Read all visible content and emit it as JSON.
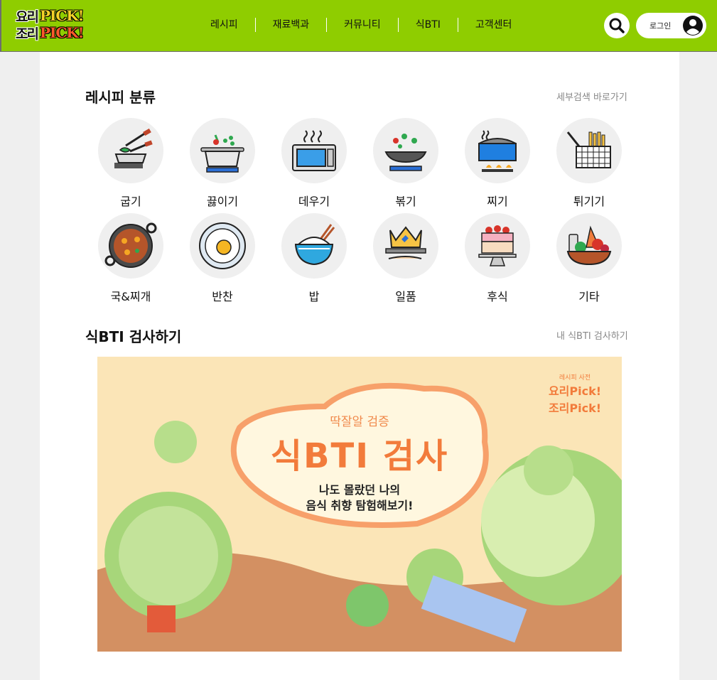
{
  "header": {
    "logo": {
      "line1_ko": "요리",
      "line1_en": "PICK!",
      "line2_ko": "조리",
      "line2_en": "PICK!"
    },
    "nav": [
      "레시피",
      "재료백과",
      "커뮤니티",
      "식BTI",
      "고객센터"
    ],
    "login_label": "로그인",
    "search_icon": "search-icon",
    "user_icon": "user-icon"
  },
  "recipe_section": {
    "title": "레시피 분류",
    "link": "세부검색 바로가기",
    "categories": [
      {
        "name": "굽기",
        "icon": "grill-icon"
      },
      {
        "name": "끓이기",
        "icon": "boil-pot-icon"
      },
      {
        "name": "데우기",
        "icon": "microwave-icon"
      },
      {
        "name": "볶기",
        "icon": "wok-icon"
      },
      {
        "name": "찌기",
        "icon": "steam-pot-icon"
      },
      {
        "name": "튀기기",
        "icon": "fryer-icon"
      },
      {
        "name": "국&찌개",
        "icon": "stew-pan-icon"
      },
      {
        "name": "반찬",
        "icon": "fried-egg-icon"
      },
      {
        "name": "밥",
        "icon": "rice-bowl-icon"
      },
      {
        "name": "일품",
        "icon": "crown-dish-icon"
      },
      {
        "name": "후식",
        "icon": "cake-icon"
      },
      {
        "name": "기타",
        "icon": "vegetable-basket-icon"
      }
    ]
  },
  "bti_section": {
    "title": "식BTI 검사하기",
    "link": "내 식BTI 검사하기",
    "banner": {
      "line1": "딱잘알 검증",
      "line2": "식BTI 검사",
      "line3": "나도 몰랐던 나의",
      "line4": "음식 취향 탐험해보기!",
      "badge_small": "레시피 사전",
      "badge_1": "요리Pick!",
      "badge_2": "조리Pick!"
    }
  },
  "colors": {
    "brand": "#8fcd00",
    "banner_bg": "#fbe5b7",
    "accent": "#f27b3b"
  }
}
